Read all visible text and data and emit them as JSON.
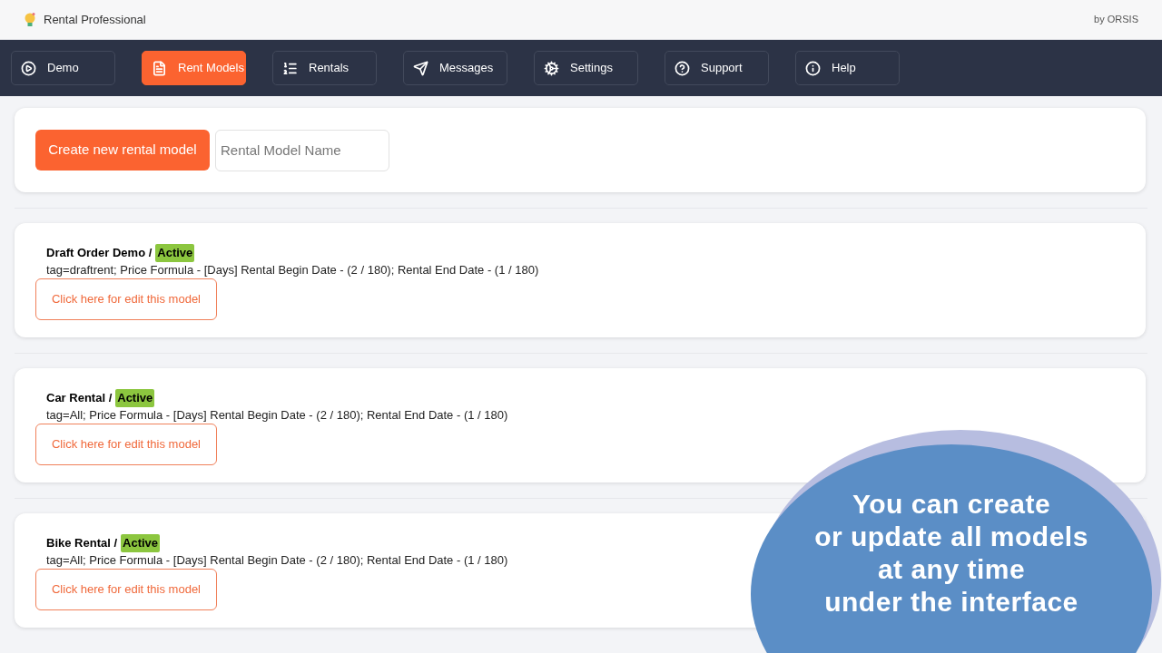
{
  "header": {
    "app_title": "Rental Professional",
    "vendor": "by ORSIS"
  },
  "nav": [
    {
      "label": "Demo",
      "kind": "play",
      "selected": false
    },
    {
      "label": "Rent Models",
      "kind": "file",
      "selected": true
    },
    {
      "label": "Rentals",
      "kind": "list",
      "selected": false
    },
    {
      "label": "Messages",
      "kind": "send",
      "selected": false
    },
    {
      "label": "Settings",
      "kind": "cogs",
      "selected": false
    },
    {
      "label": "Support",
      "kind": "help",
      "selected": false
    },
    {
      "label": "Help",
      "kind": "info",
      "selected": false
    }
  ],
  "create": {
    "button": "Create new rental model",
    "placeholder": "Rental Model Name"
  },
  "models": [
    {
      "name": "Draft Order Demo /",
      "status": "Active",
      "details": "tag=draftrent; Price Formula - [Days] Rental Begin Date - (2 / 180); Rental End Date - (1 / 180)",
      "edit": "Click here for edit this model"
    },
    {
      "name": "Car Rental /",
      "status": "Active",
      "details": "tag=All; Price Formula - [Days] Rental Begin Date - (2 / 180); Rental End Date - (1 / 180)",
      "edit": "Click here for edit this model"
    },
    {
      "name": "Bike Rental /",
      "status": "Active",
      "details": "tag=All; Price Formula - [Days] Rental Begin Date - (2 / 180); Rental End Date - (1 / 180)",
      "edit": "Click here for edit this model"
    }
  ],
  "callout": {
    "lines": [
      "You can create",
      "or update all models",
      "at any time",
      "under the interface"
    ]
  }
}
